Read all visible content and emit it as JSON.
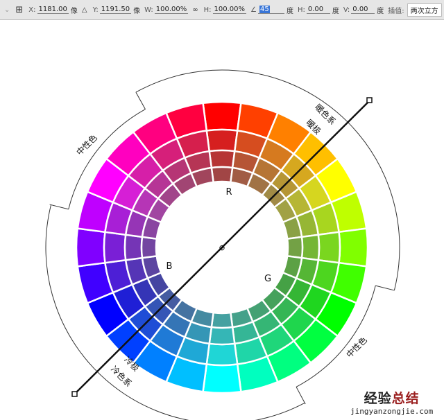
{
  "toolbar": {
    "x_label": "X:",
    "x_value": "1181.00",
    "x_unit": "像",
    "y_label": "Y:",
    "y_value": "1191.50",
    "y_unit": "像",
    "w_label": "W:",
    "w_value": "100.00%",
    "h_label": "H:",
    "h_value": "100.00%",
    "angle_value": "45",
    "angle_unit": "度",
    "skew_h_label": "H:",
    "skew_h_value": "0.00",
    "skew_h_unit": "度",
    "skew_v_label": "V:",
    "skew_v_value": "0.00",
    "skew_v_unit": "度",
    "interp_label": "插值:",
    "interp_value": "两次立方"
  },
  "wheel": {
    "labels": {
      "r": "R",
      "g": "G",
      "b": "B",
      "warm_system": "暖色系",
      "warm_pole": "暖极",
      "cold_pole": "冷极",
      "cold_system": "冷色系",
      "neutral_left": "中性色",
      "neutral_right": "中性色"
    },
    "segments": 24,
    "rings": 4
  },
  "watermark": {
    "title_a": "经验",
    "title_b": "总结",
    "url": "jingyanzongjie.com"
  }
}
